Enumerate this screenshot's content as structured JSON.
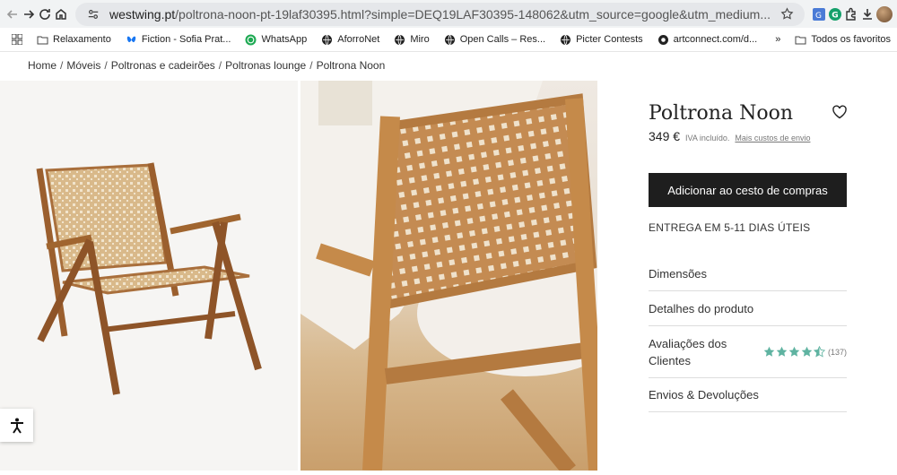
{
  "browser": {
    "url_host": "westwing.pt",
    "url_rest": "/poltrona-noon-pt-19laf30395.html?simple=DEQ19LAF30395-148062&utm_source=google&utm_medium..."
  },
  "bookmarks": {
    "items": [
      {
        "label": "Relaxamento",
        "icon": "folder-icon"
      },
      {
        "label": "Fiction - Sofia Prat...",
        "icon": "butterfly-icon"
      },
      {
        "label": "WhatsApp",
        "icon": "whatsapp-icon"
      },
      {
        "label": "AforroNet",
        "icon": "globe-icon"
      },
      {
        "label": "Miro",
        "icon": "globe-icon"
      },
      {
        "label": "Open Calls – Res...",
        "icon": "globe-icon"
      },
      {
        "label": "Picter Contests",
        "icon": "globe-icon"
      },
      {
        "label": "artconnect.com/d...",
        "icon": "globe-icon"
      }
    ],
    "overflow": "»",
    "all_bookmarks": "Todos os favoritos"
  },
  "breadcrumb": {
    "items": [
      "Home",
      "Móveis",
      "Poltronas e cadeirões",
      "Poltronas lounge",
      "Poltrona Noon"
    ],
    "separator": "/"
  },
  "product": {
    "title": "Poltrona Noon",
    "price": "349 €",
    "vat_note": "IVA incluído.",
    "shipping_link": "Mais custos de envio",
    "add_to_cart": "Adicionar ao cesto de compras",
    "delivery": "ENTREGA EM 5-11 DIAS ÚTEIS",
    "sections": {
      "dimensions": "Dimensões",
      "details": "Detalhes do produto",
      "reviews": "Avaliações dos Clientes",
      "shipping_returns": "Envios & Devoluções"
    },
    "rating": 4.5,
    "rating_max": 5,
    "review_count": "(137)"
  },
  "colors": {
    "star": "#5fb3a1",
    "cart_button": "#1e1e1e"
  }
}
